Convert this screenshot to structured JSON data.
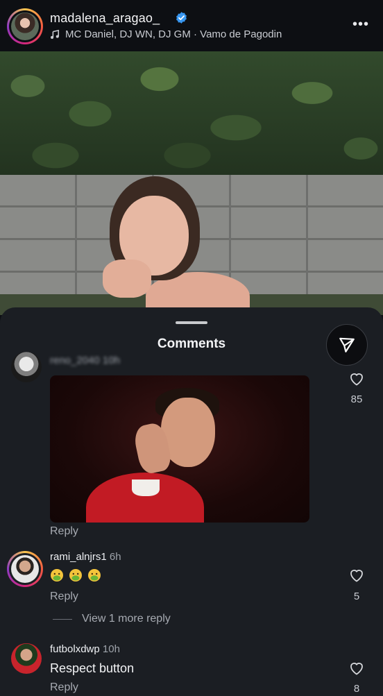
{
  "header": {
    "username": "madalena_aragao_",
    "music": "MC Daniel, DJ WN, DJ GM · Vamo de Pagodin",
    "more": "•••"
  },
  "comments_sheet": {
    "title": "Comments",
    "comments": [
      {
        "username": "reno_2040",
        "time": "10h",
        "reply_label": "Reply",
        "likes": "85"
      },
      {
        "username": "rami_alnjrs1",
        "time": "6h",
        "reply_label": "Reply",
        "likes": "5",
        "view_more": "View 1 more reply"
      },
      {
        "username": "futbolxdwp",
        "time": "10h",
        "text": "Respect button",
        "reply_label": "Reply",
        "likes": "8"
      }
    ]
  },
  "colors": {
    "background": "#0e1014",
    "sheet": "#1b1e23",
    "verified": "#3897f0",
    "ring_gradient": [
      "#f9c64d",
      "#f45b3f",
      "#d4267c",
      "#8f3ac4"
    ]
  },
  "icons": {
    "verified": "verified-badge-icon",
    "music": "music-note-icon",
    "share": "send-icon",
    "like": "heart-icon",
    "emoji": "nauseated-face-emoji"
  }
}
